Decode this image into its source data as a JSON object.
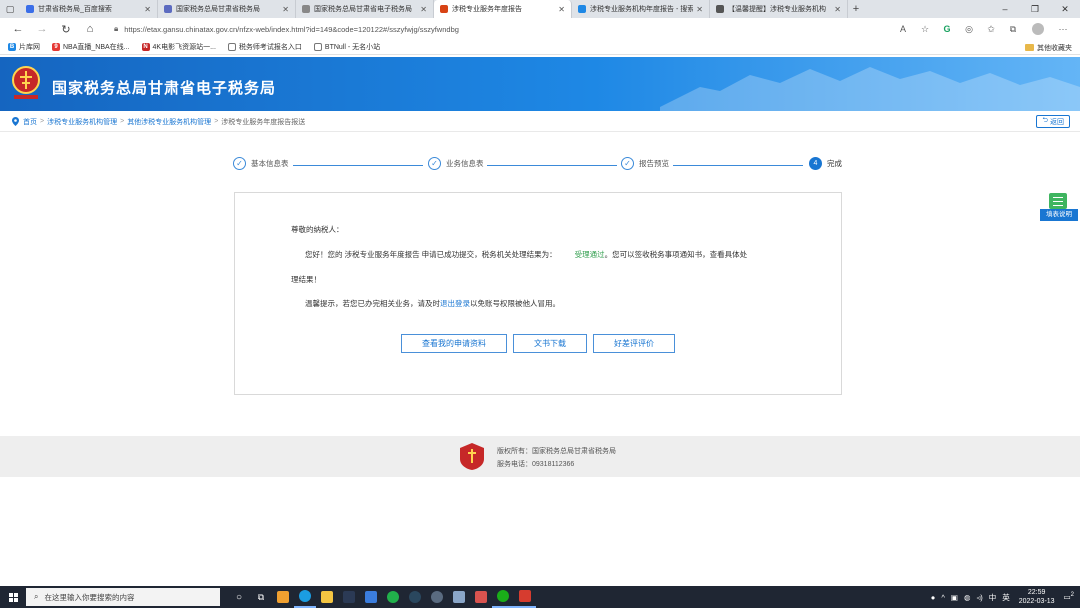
{
  "browser": {
    "tabs": [
      {
        "label": "甘肃省税务局_百度搜索",
        "color": "#3a6ee8"
      },
      {
        "label": "国家税务总局甘肃省税务局",
        "color": "#5c6bc0"
      },
      {
        "label": "国家税务总局甘肃省电子税务局",
        "color": "#888888"
      },
      {
        "label": "涉税专业服务年度报告",
        "color": "#d84315"
      },
      {
        "label": "涉税专业服务机构年度报告 - 搜索",
        "color": "#1e88e5"
      },
      {
        "label": "【温馨提醒】涉税专业服务机构",
        "color": "#555555"
      }
    ],
    "active_tab": 3,
    "url": "https://etax.gansu.chinatax.gov.cn/nfzx-web/index.html?id=149&code=120122#/sszyfwjg/sszyfwndbg",
    "bookmarks": [
      {
        "label": "片库网",
        "color": "#1e88e5",
        "glyph": "B"
      },
      {
        "label": "NBA直播_NBA在线...",
        "color": "#e53935",
        "glyph": "9"
      },
      {
        "label": "4K电影飞资源站一...",
        "color": "#c62828",
        "glyph": "N"
      },
      {
        "label": "税务师考试报名入口",
        "color": "#ffffff",
        "glyph": ""
      },
      {
        "label": "BTNull - 无名小站",
        "color": "#ffffff",
        "glyph": ""
      }
    ],
    "bookmarks_other": "其他收藏夹"
  },
  "site": {
    "title": "国家税务总局甘肃省电子税务局"
  },
  "breadcrumb": {
    "items": [
      "首页",
      "涉税专业服务机构管理",
      "其他涉税专业服务机构管理",
      "涉税专业服务年度报告报送"
    ],
    "back_label": "返回"
  },
  "steps": [
    {
      "label": "基本信息表",
      "state": "done",
      "mark": "✓"
    },
    {
      "label": "业务信息表",
      "state": "done",
      "mark": "✓"
    },
    {
      "label": "报告预览",
      "state": "done",
      "mark": "✓"
    },
    {
      "label": "完成",
      "state": "current",
      "mark": "4"
    }
  ],
  "message": {
    "greeting": "尊敬的纳税人：",
    "line1_a": "您好！您的 涉税专业服务年度报告 申请已成功提交，税务机关处理结果为：",
    "line1_status": "受理通过",
    "line1_b": "。您可以签收税务事项通知书，查看具体处",
    "line2": "理结果！",
    "line3_a": "温馨提示，若您已办完相关业务，请及时",
    "line3_link": "退出登录",
    "line3_b": "以免账号权限被他人冒用。"
  },
  "buttons": {
    "view_application": "查看我的申请资料",
    "download_doc": "文书下载",
    "rate_feedback": "好差评评价"
  },
  "help": {
    "label": "填表说明"
  },
  "footer": {
    "copyright": "版权所有：国家税务总局甘肃省税务局",
    "phone": "服务电话：09318112366"
  },
  "taskbar": {
    "search_placeholder": "在这里输入你要搜索的内容",
    "time": "22:59",
    "date": "2022-03-13",
    "ime": "中",
    "ime2": "英",
    "notification_count": "2"
  }
}
